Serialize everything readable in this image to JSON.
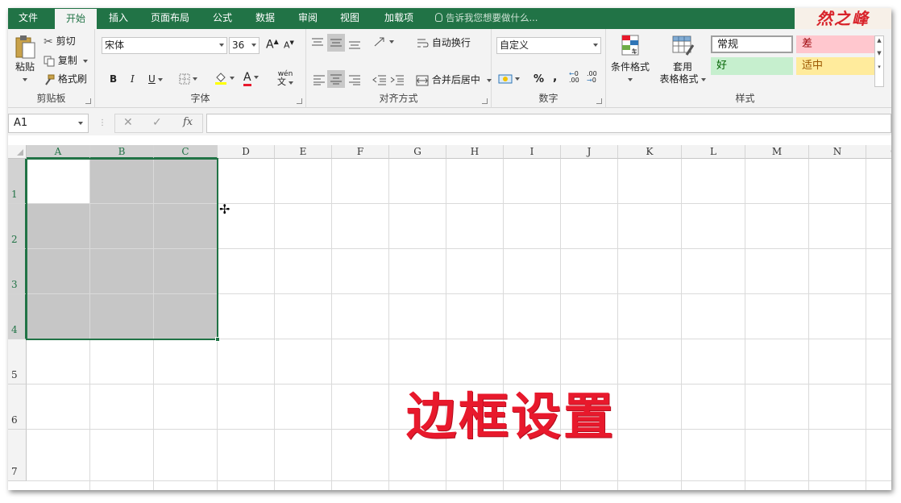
{
  "tabs": [
    "文件",
    "开始",
    "插入",
    "页面布局",
    "公式",
    "数据",
    "审阅",
    "视图",
    "加载项"
  ],
  "active_tab": "开始",
  "tell_me_placeholder": "告诉我您想要做什么...",
  "logo_text": "然之峰",
  "clipboard": {
    "label": "剪贴板",
    "paste": "粘贴",
    "cut": "剪切",
    "copy": "复制",
    "format_painter": "格式刷"
  },
  "font": {
    "label": "字体",
    "name": "宋体",
    "size": "36",
    "bold": "B",
    "italic": "I",
    "underline": "U",
    "grow": "A",
    "shrink": "A",
    "phonetic": "wén"
  },
  "alignment": {
    "label": "对齐方式",
    "wrap_text": "自动换行",
    "merge_center": "合并后居中"
  },
  "number": {
    "label": "数字",
    "format": "自定义",
    "percent": "%",
    "comma": ",",
    "inc_decimal": ".00",
    "dec_decimal": ".00"
  },
  "styles": {
    "label": "样式",
    "conditional_format": "条件格式",
    "format_as_table_1": "套用",
    "format_as_table_2": "表格格式",
    "cells": [
      {
        "name": "常规",
        "bg": "#ffffff",
        "fg": "#222222",
        "border": "#a0a0a0"
      },
      {
        "name": "差",
        "bg": "#ffc7ce",
        "fg": "#9c0006",
        "border": "#ffc7ce"
      },
      {
        "name": "好",
        "bg": "#c6efce",
        "fg": "#006100",
        "border": "#c6efce"
      },
      {
        "name": "适中",
        "bg": "#ffeb9c",
        "fg": "#9c5700",
        "border": "#ffeb9c"
      }
    ]
  },
  "formula_bar": {
    "name_box": "A1",
    "cancel": "✕",
    "enter": "✓",
    "fx": "fx",
    "value": ""
  },
  "grid": {
    "columns": [
      "A",
      "B",
      "C",
      "D",
      "E",
      "F",
      "G",
      "H",
      "I",
      "J",
      "K",
      "L",
      "M",
      "N",
      "O"
    ],
    "rows": [
      "1",
      "2",
      "3",
      "4",
      "5",
      "6",
      "7"
    ],
    "selection": "A1:C4",
    "selected_columns": [
      "A",
      "B",
      "C"
    ],
    "selected_rows": [
      "1",
      "2",
      "3",
      "4"
    ]
  },
  "overlay_title": "边框设置",
  "colors": {
    "accent": "#217346",
    "overlay": "#e8192c"
  }
}
